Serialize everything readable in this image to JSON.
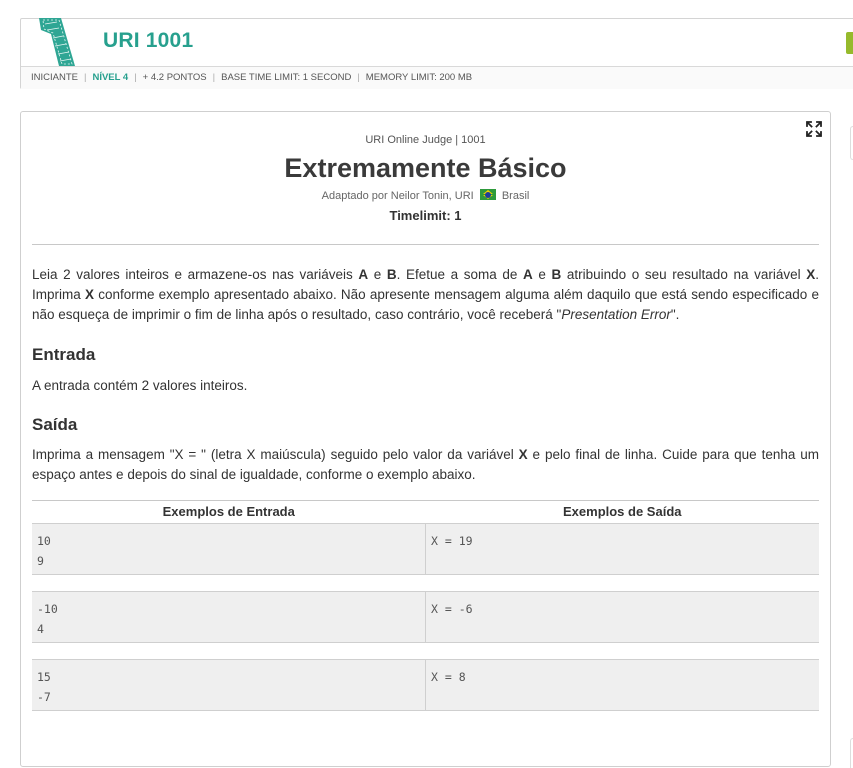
{
  "header": {
    "problem_code": "URI 1001",
    "meta": {
      "category": "INICIANTE",
      "level": "NÍVEL 4",
      "points": "+ 4.2 PONTOS",
      "base_time_limit": "BASE TIME LIMIT: 1 SECOND",
      "memory_limit": "MEMORY LIMIT: 200 MB"
    }
  },
  "problem": {
    "judge": "URI Online Judge | 1001",
    "title": "Extremamente Básico",
    "author_prefix": "Adaptado por Neilor Tonin, URI",
    "country": "Brasil",
    "timelimit": "Timelimit: 1",
    "description": {
      "p1": "Leia 2 valores inteiros e armazene-os nas variáveis ",
      "var_a": "A",
      "p2": " e ",
      "var_b": "B",
      "p3": ". Efetue a soma de ",
      "var_a2": "A",
      "p4": " e ",
      "var_b2": "B",
      "p5": " atribuindo o seu resultado na variável ",
      "var_x": "X",
      "p6": ". Imprima ",
      "var_x2": "X",
      "p7": " conforme exemplo apresentado abaixo. Não apresente mensagem alguma além daquilo que está sendo especificado e não esqueça de imprimir o fim de linha após o resultado, caso contrário, você receberá \"",
      "error_name": "Presentation Error",
      "p8": "\"."
    },
    "input_section": {
      "title": "Entrada",
      "text": "A entrada contém 2 valores inteiros."
    },
    "output_section": {
      "title": "Saída",
      "p1": "Imprima a mensagem \"X = \" (letra X maiúscula) seguido pelo valor da variável ",
      "var_x": "X",
      "p2": " e pelo final de linha. Cuide para que tenha um espaço antes e depois do sinal de igualdade, conforme o exemplo abaixo."
    },
    "examples": {
      "input_header": "Exemplos de Entrada",
      "output_header": "Exemplos de Saída",
      "rows": [
        {
          "input": "10\n9",
          "output": "X = 19"
        },
        {
          "input": "-10\n4",
          "output": "X = -6"
        },
        {
          "input": "15\n-7",
          "output": "X = 8"
        }
      ]
    }
  },
  "colors": {
    "accent": "#27a08e",
    "tab_green": "#96ba2c"
  },
  "icons": {
    "logo": "stylized-number-one-logo",
    "expand": "expand-fullscreen-icon",
    "flag": "brazil-flag-icon"
  }
}
